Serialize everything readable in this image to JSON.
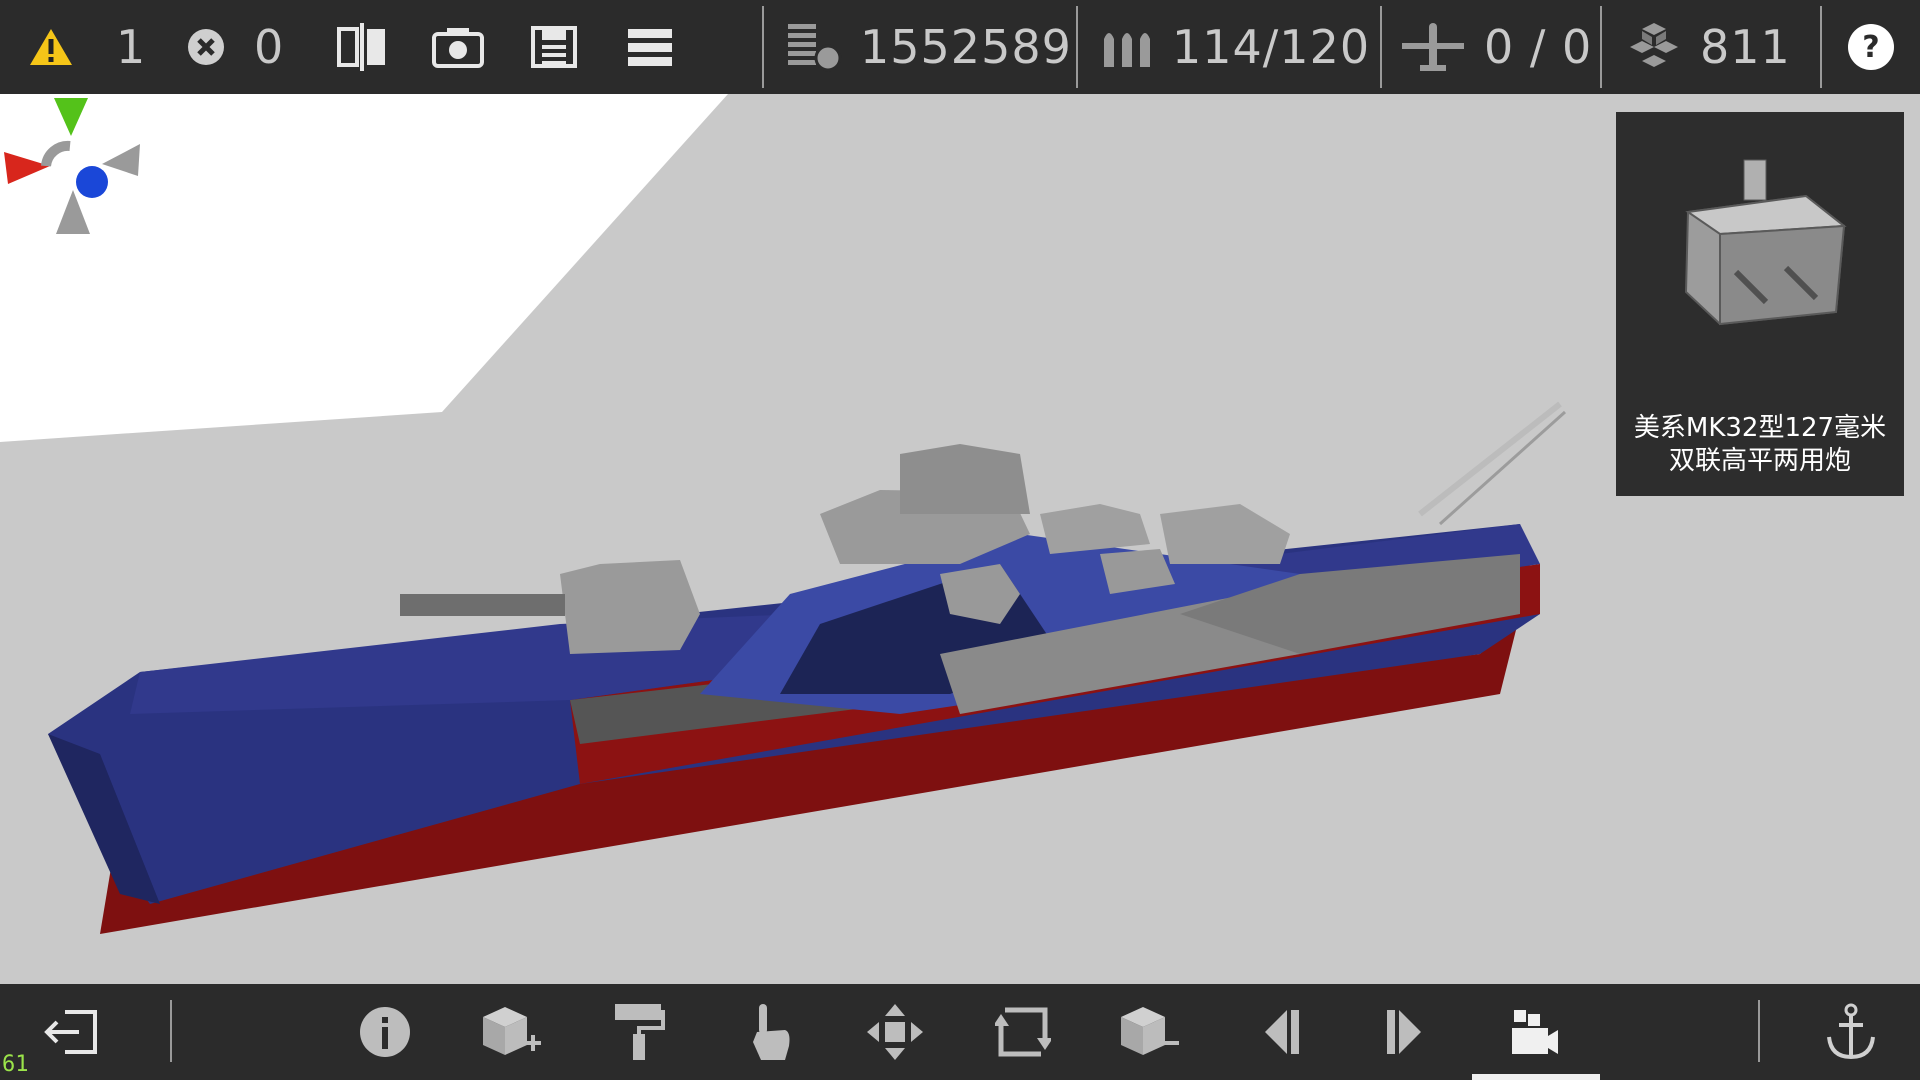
{
  "topbar": {
    "warnings": "1",
    "errors": "0",
    "cost": "1552589",
    "ammo": "114/120",
    "aircraft": "0 / 0",
    "parts": "811"
  },
  "selected_part": {
    "name_line1": "美系MK32型127毫米",
    "name_line2": "双联高平两用炮"
  },
  "fps": "61",
  "icons": {
    "warning": "warning-icon",
    "error": "error-icon",
    "mirror": "mirror-icon",
    "camera": "camera-icon",
    "save": "save-icon",
    "menu": "menu-icon",
    "cost": "cost-icon",
    "ammo": "ammo-icon",
    "aircraft": "aircraft-icon",
    "parts": "parts-icon",
    "help": "help-icon"
  },
  "colors": {
    "bar": "#2b2b2b",
    "warning": "#f5c518",
    "hull_blue": "#2b3480",
    "hull_red": "#8a1414"
  }
}
